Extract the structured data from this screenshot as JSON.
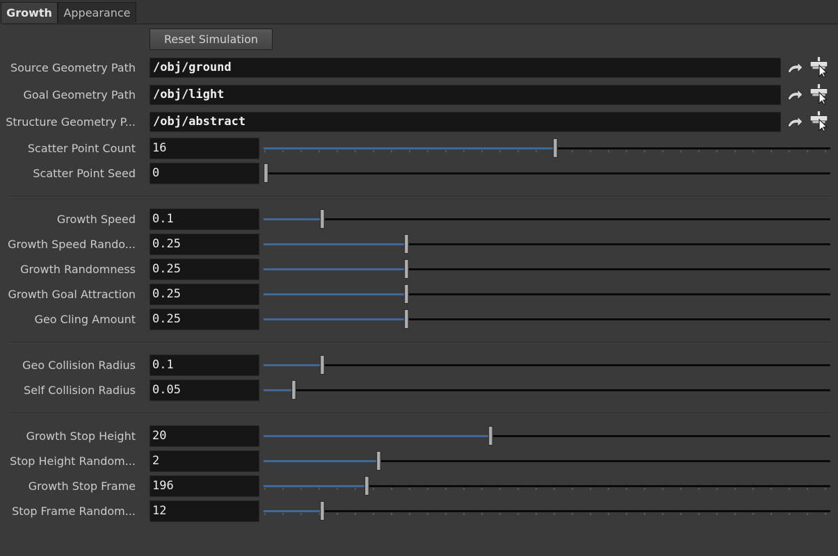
{
  "tabs": [
    {
      "label": "Growth",
      "active": true
    },
    {
      "label": "Appearance",
      "active": false
    }
  ],
  "reset_button": "Reset Simulation",
  "paths": [
    {
      "label": "Source Geometry Path",
      "value": "/obj/ground"
    },
    {
      "label": "Goal Geometry Path",
      "value": "/obj/light"
    },
    {
      "label": "Structure Geometry P...",
      "value": "/obj/abstract"
    }
  ],
  "path_icons": [
    "jump-to-node-icon",
    "select-node-icon"
  ],
  "params": [
    {
      "label": "Scatter Point Count",
      "value": "16",
      "fraction": 0.515,
      "ticks": true
    },
    {
      "label": "Scatter Point Seed",
      "value": "0",
      "fraction": 0.0,
      "ticks": false
    },
    {
      "label": "Growth Speed",
      "value": "0.1",
      "fraction": 0.1,
      "ticks": false
    },
    {
      "label": "Growth Speed Rando...",
      "value": "0.25",
      "fraction": 0.25,
      "ticks": false
    },
    {
      "label": "Growth Randomness",
      "value": "0.25",
      "fraction": 0.25,
      "ticks": false
    },
    {
      "label": "Growth Goal Attraction",
      "value": "0.25",
      "fraction": 0.25,
      "ticks": false
    },
    {
      "label": "Geo Cling Amount",
      "value": "0.25",
      "fraction": 0.25,
      "ticks": false
    },
    {
      "label": "Geo Collision Radius",
      "value": "0.1",
      "fraction": 0.1,
      "ticks": false
    },
    {
      "label": "Self Collision Radius",
      "value": "0.05",
      "fraction": 0.05,
      "ticks": false
    },
    {
      "label": "Growth Stop Height",
      "value": "20",
      "fraction": 0.4,
      "ticks": false
    },
    {
      "label": "Stop Height Random...",
      "value": "2",
      "fraction": 0.2,
      "ticks": false
    },
    {
      "label": "Growth Stop Frame",
      "value": "196",
      "fraction": 0.18,
      "ticks": true
    },
    {
      "label": "Stop Frame Random...",
      "value": "12",
      "fraction": 0.1,
      "ticks": true
    }
  ],
  "colors": {
    "background": "#3a3a3a",
    "field": "#161616",
    "slider_fill": "#3f6a98",
    "track": "#090909"
  }
}
